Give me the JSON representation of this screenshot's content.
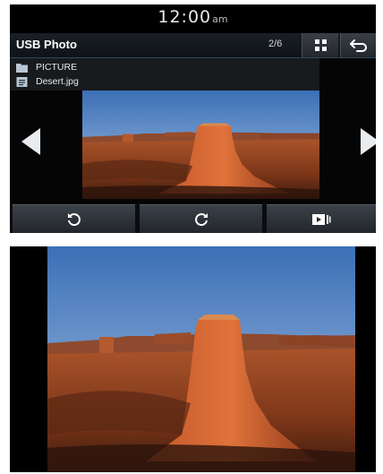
{
  "status": {
    "time": "12:00",
    "ampm": "am"
  },
  "header": {
    "title": "USB Photo",
    "counter": "2/6"
  },
  "breadcrumb": {
    "folder": "PICTURE",
    "file": "Desert.jpg"
  },
  "colors": {
    "accent_line": "#2b4a5e",
    "button_top": "#3b4148",
    "background": "#000000"
  },
  "icons": {
    "grid": "grid-icon",
    "back": "back-arrow-icon",
    "folder": "folder-icon",
    "file": "image-file-icon",
    "prev": "previous-arrow-icon",
    "next": "next-arrow-icon",
    "rotate_left": "rotate-left-icon",
    "rotate_right": "rotate-right-icon",
    "slideshow": "slideshow-icon"
  }
}
